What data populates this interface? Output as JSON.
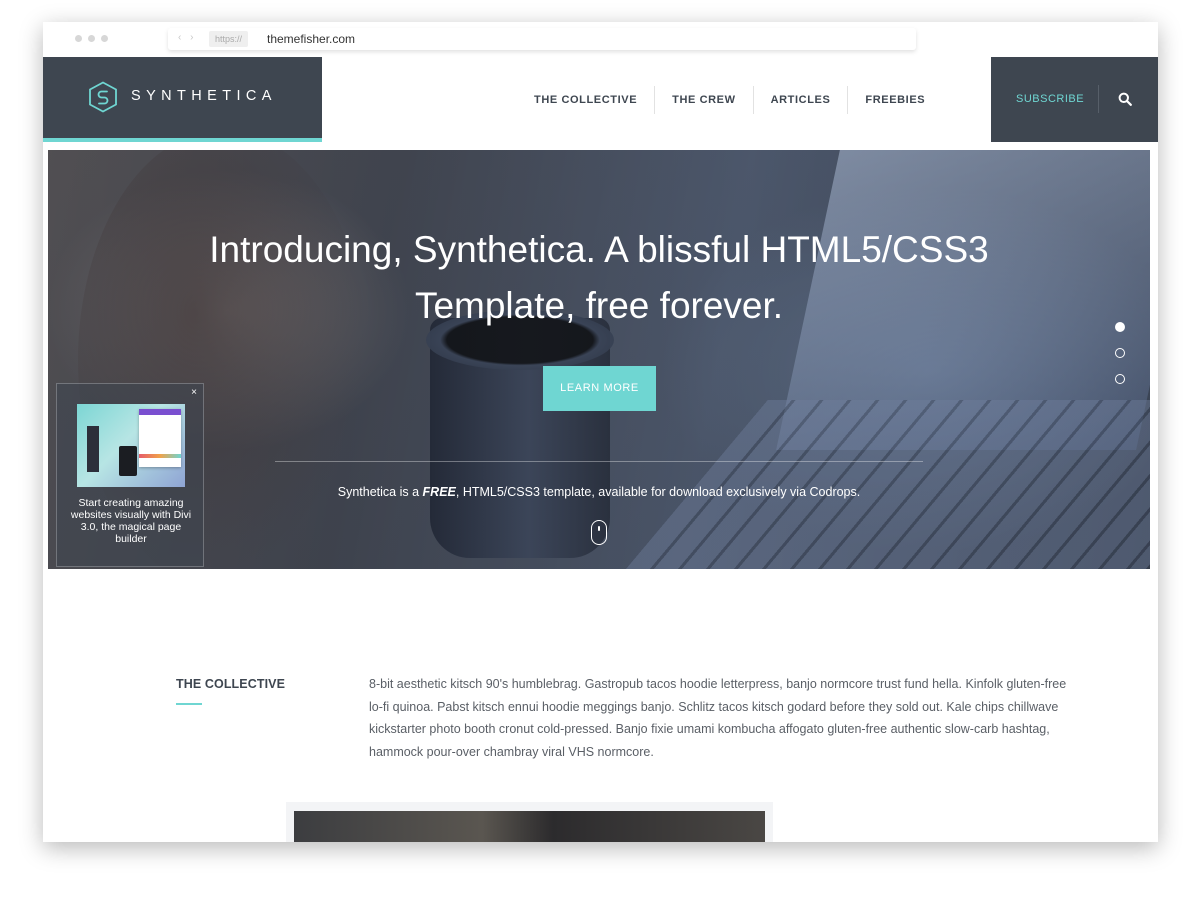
{
  "browser": {
    "protocol": "https://",
    "host": "themefisher.com",
    "nav_arrows": "‹ ›"
  },
  "header": {
    "brand_name": "SYNTHETICA",
    "logo_icon": "hexagon-s-icon",
    "nav": [
      "THE COLLECTIVE",
      "THE CREW",
      "ARTICLES",
      "FREEBIES"
    ],
    "subscribe_label": "SUBSCRIBE",
    "search_icon": "search-icon"
  },
  "hero": {
    "title": "Introducing, Synthetica. A blissful HTML5/CSS3 Template, free forever.",
    "button_label": "LEARN MORE",
    "note_prefix": "Synthetica is a ",
    "note_emphasis": "FREE",
    "note_suffix": ", HTML5/CSS3 template, available for download exclusively via Codrops.",
    "slides": {
      "count": 3,
      "active_index": 0
    }
  },
  "promo": {
    "close_label": "×",
    "text": "Start creating amazing websites visually with Divi 3.0, the magical page builder"
  },
  "section": {
    "title": "THE COLLECTIVE",
    "body": "8-bit aesthetic kitsch 90's humblebrag. Gastropub tacos hoodie letterpress, banjo normcore trust fund hella. Kinfolk gluten-free lo-fi quinoa. Pabst kitsch ennui hoodie meggings banjo. Schlitz tacos kitsch godard before they sold out. Kale chips chillwave kickstarter photo booth cronut cold-pressed. Banjo fixie umami kombucha affogato gluten-free authentic slow-carb hashtag, hammock pour-over chambray viral VHS normcore."
  },
  "colors": {
    "dark": "#3e4650",
    "accent": "#6fd6d2",
    "text": "#5a5f66"
  }
}
